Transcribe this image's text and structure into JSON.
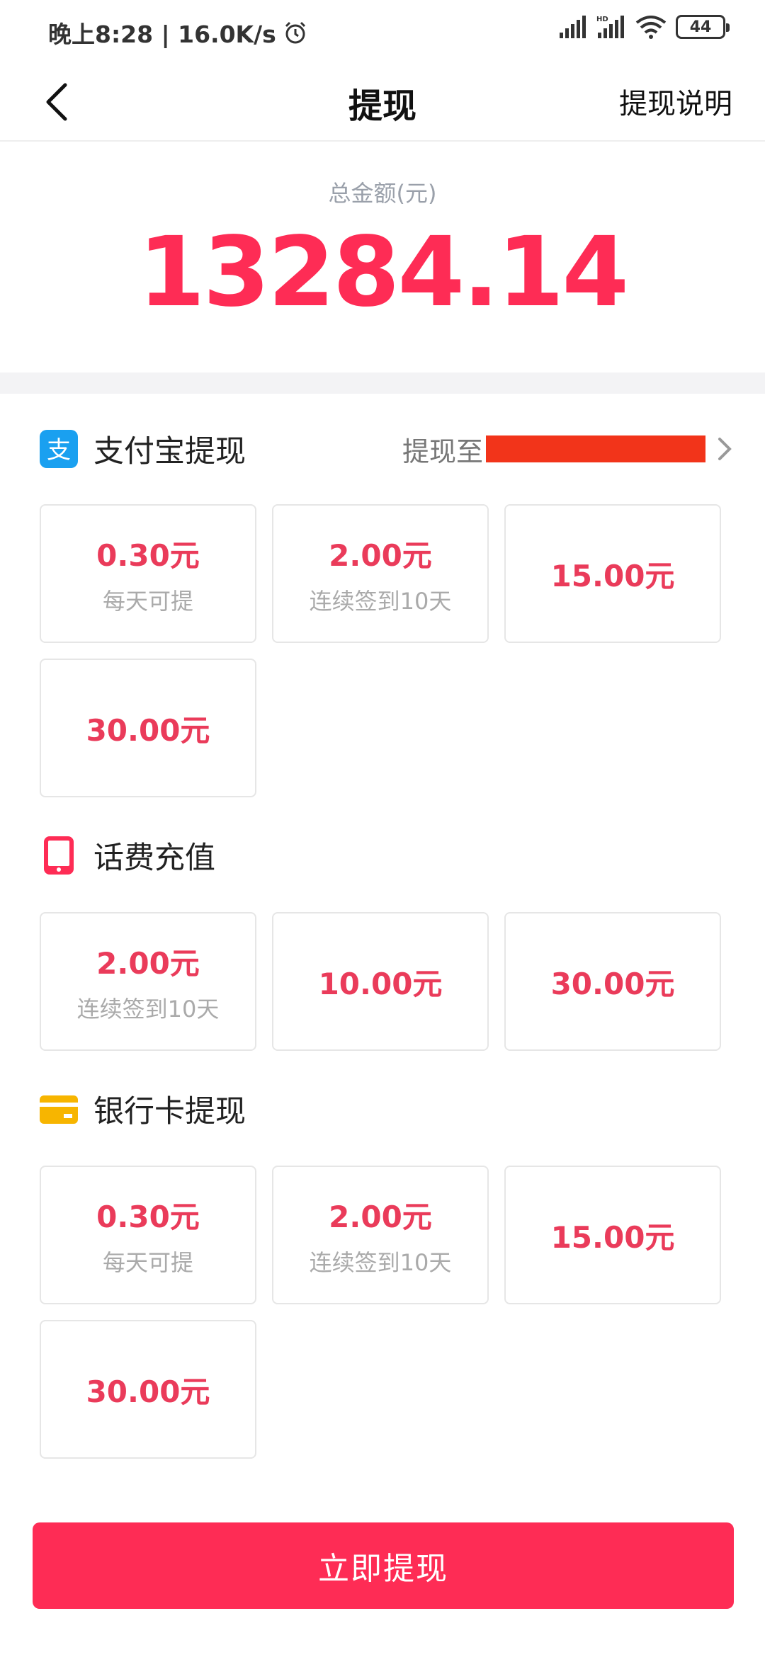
{
  "status_bar": {
    "time_speed": "晚上8:28 | 16.0K/s",
    "battery": "44",
    "hd_label": "HD"
  },
  "nav": {
    "title": "提现",
    "right_link": "提现说明"
  },
  "total": {
    "label": "总金额(元)",
    "amount": "13284.14"
  },
  "alipay": {
    "title": "支付宝提现",
    "target_label": "提现至",
    "icon_glyph": "支",
    "options": [
      {
        "amount": "0.30元",
        "sub": "每天可提"
      },
      {
        "amount": "2.00元",
        "sub": "连续签到10天"
      },
      {
        "amount": "15.00元",
        "sub": ""
      },
      {
        "amount": "30.00元",
        "sub": ""
      }
    ]
  },
  "phone": {
    "title": "话费充值",
    "options": [
      {
        "amount": "2.00元",
        "sub": "连续签到10天"
      },
      {
        "amount": "10.00元",
        "sub": ""
      },
      {
        "amount": "30.00元",
        "sub": ""
      }
    ]
  },
  "bank": {
    "title": "银行卡提现",
    "options": [
      {
        "amount": "0.30元",
        "sub": "每天可提"
      },
      {
        "amount": "2.00元",
        "sub": "连续签到10天"
      },
      {
        "amount": "15.00元",
        "sub": ""
      },
      {
        "amount": "30.00元",
        "sub": ""
      }
    ]
  },
  "submit_label": "立即提现",
  "colors": {
    "accent": "#fe2c55",
    "option_text": "#ea3b5a",
    "alipay_blue": "#1aa0f0",
    "bank_yellow": "#f7b500",
    "redaction": "#f2341a"
  }
}
